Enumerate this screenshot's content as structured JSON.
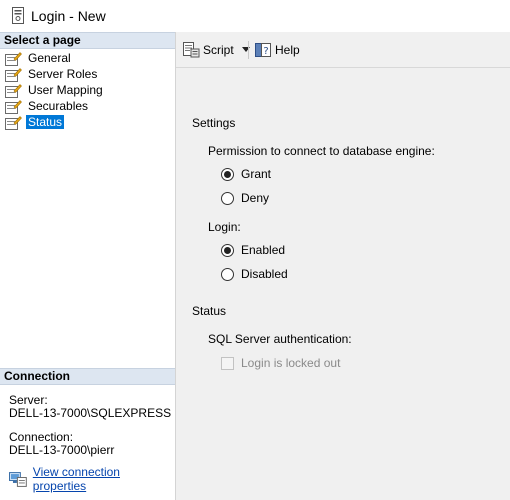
{
  "window": {
    "title": "Login - New"
  },
  "select_page": {
    "header": "Select a page",
    "items": [
      {
        "label": "General",
        "selected": false
      },
      {
        "label": "Server Roles",
        "selected": false
      },
      {
        "label": "User Mapping",
        "selected": false
      },
      {
        "label": "Securables",
        "selected": false
      },
      {
        "label": "Status",
        "selected": true
      }
    ]
  },
  "connection": {
    "header": "Connection",
    "server_label": "Server:",
    "server_value": "DELL-13-7000\\SQLEXPRESS",
    "connection_label": "Connection:",
    "connection_value": "DELL-13-7000\\pierr",
    "properties_link": "View connection properties"
  },
  "toolbar": {
    "script_label": "Script",
    "help_label": "Help"
  },
  "settings": {
    "title": "Settings",
    "permission_label": "Permission to connect to database engine:",
    "permission_options": [
      {
        "label": "Grant",
        "checked": true
      },
      {
        "label": "Deny",
        "checked": false
      }
    ],
    "login_label": "Login:",
    "login_options": [
      {
        "label": "Enabled",
        "checked": true
      },
      {
        "label": "Disabled",
        "checked": false
      }
    ]
  },
  "status": {
    "title": "Status",
    "auth_label": "SQL Server authentication:",
    "locked_out_label": "Login is locked out",
    "locked_out_checked": false,
    "locked_out_enabled": false
  },
  "colors": {
    "selection": "#0078d7",
    "link": "#0645ad",
    "panel_bg": "#f0f0f0",
    "header_bg": "#dde6f1"
  }
}
